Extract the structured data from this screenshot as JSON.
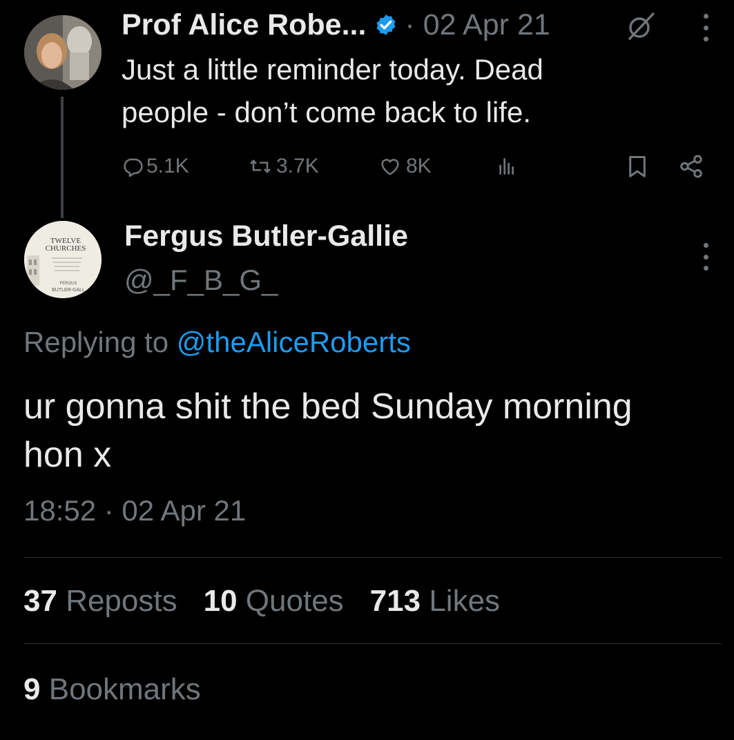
{
  "parent_tweet": {
    "display_name": "Prof Alice Robe...",
    "date": "· 02 Apr 21",
    "text_lines": [
      "Just a little reminder today. Dead",
      "people - don’t come back to life."
    ],
    "actions": {
      "replies": "5.1K",
      "reposts": "3.7K",
      "likes": "8K"
    },
    "icons": [
      "verified-badge-icon",
      "grok-icon",
      "more-icon",
      "reply-icon",
      "repost-icon",
      "like-icon",
      "views-icon",
      "bookmark-icon",
      "share-icon"
    ]
  },
  "focal_tweet": {
    "display_name": "Fergus Butler-Gallie",
    "handle": "@_F_B_G_",
    "avatar_text": {
      "title_lines": [
        "TWELVE",
        "CHURCHES"
      ],
      "author_lines": [
        "FERGUS",
        "BUTLER-GALL"
      ]
    },
    "replying_prefix": "Replying to",
    "replying_mention": "@theAliceRoberts",
    "text_lines": [
      "ur gonna shit the bed Sunday morning",
      "hon x"
    ],
    "timestamp": "18:52 · 02 Apr 21",
    "stats": {
      "reposts_count": "37",
      "reposts_label": "Reposts",
      "quotes_count": "10",
      "quotes_label": "Quotes",
      "likes_count": "713",
      "likes_label": "Likes",
      "bookmarks_count": "9",
      "bookmarks_label": "Bookmarks"
    }
  },
  "colors": {
    "background": "#000000",
    "text_primary": "#e7e9ea",
    "text_secondary": "#71767b",
    "link": "#1d9bf0",
    "divider": "#2f3336",
    "verified": "#1d9bf0"
  }
}
